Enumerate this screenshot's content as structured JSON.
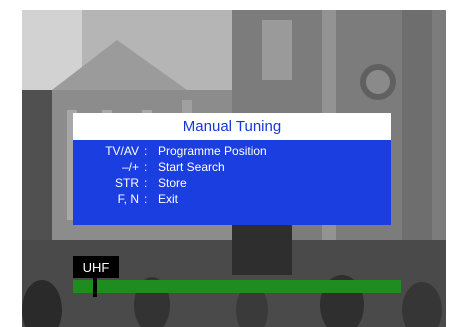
{
  "osd": {
    "title": "Manual Tuning",
    "rows": [
      {
        "key": "TV/AV",
        "sep": ":",
        "function": "Programme Position"
      },
      {
        "key": "–/+",
        "sep": ":",
        "function": "Start Search"
      },
      {
        "key": "STR",
        "sep": ":",
        "function": "Store"
      },
      {
        "key": "F, N",
        "sep": ":",
        "function": "Exit"
      }
    ]
  },
  "band": "UHF",
  "tuning": {
    "level": 1.0,
    "marker_position": 0.06
  },
  "colors": {
    "osd_blue": "#1b3ee0",
    "title_text": "#1438d6",
    "bar_green": "#1f8c1f"
  }
}
